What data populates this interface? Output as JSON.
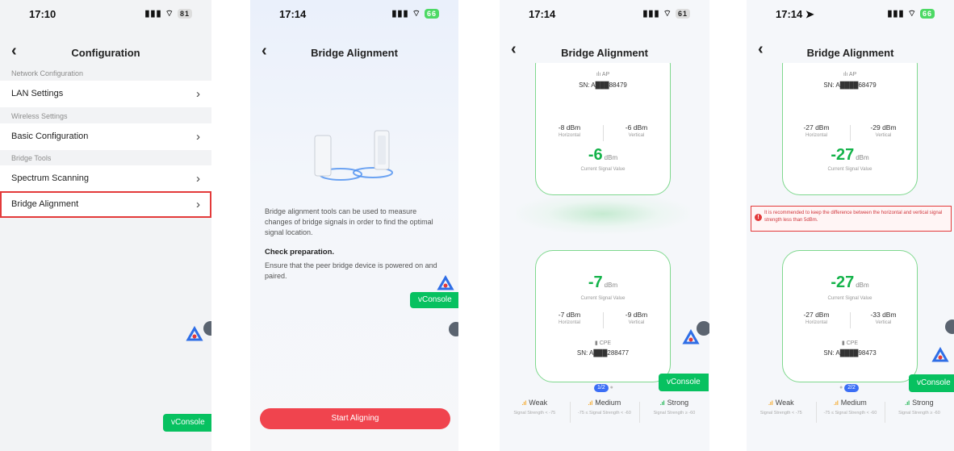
{
  "screen1": {
    "status": {
      "time": "17:10",
      "battery": "81"
    },
    "title": "Configuration",
    "sections": [
      {
        "label": "Network Configuration",
        "items": [
          "LAN Settings"
        ]
      },
      {
        "label": "Wireless Settings",
        "items": [
          "Basic Configuration"
        ]
      },
      {
        "label": "Bridge Tools",
        "items": [
          "Spectrum Scanning",
          "Bridge Alignment"
        ]
      }
    ],
    "vconsole": "vConsole"
  },
  "screen2": {
    "status": {
      "time": "17:14",
      "battery": "66"
    },
    "title": "Bridge Alignment",
    "description": "Bridge alignment tools can be used to measure changes of bridge signals in order to find the optimal signal location.",
    "check_title": "Check preparation.",
    "check_text": "Ensure that the peer bridge device is powered on and paired.",
    "start_button": "Start Aligning",
    "vconsole": "vConsole"
  },
  "screen3": {
    "status": {
      "time": "17:14",
      "battery": "61"
    },
    "title": "Bridge Alignment",
    "ap_card": {
      "role": "AP",
      "sn": "SN: A███88479",
      "horizontal": "-8 dBm",
      "vertical": "-6 dBm",
      "h_label": "Horizontal",
      "v_label": "Vertical",
      "current_value": "-6",
      "unit": "dBm",
      "current_label": "Current Signal Value"
    },
    "cpe_card": {
      "role": "CPE",
      "sn": "SN: A███288477",
      "horizontal": "-7 dBm",
      "vertical": "-9 dBm",
      "h_label": "Horizontal",
      "v_label": "Vertical",
      "current_value": "-7",
      "unit": "dBm",
      "current_label": "Current Signal Value"
    },
    "pager": "1/2",
    "vconsole": "vConsole"
  },
  "screen4": {
    "status": {
      "time": "17:14",
      "battery": "66"
    },
    "title": "Bridge Alignment",
    "ap_card": {
      "role": "AP",
      "sn": "SN: A████68479",
      "horizontal": "-27 dBm",
      "vertical": "-29 dBm",
      "h_label": "Horizontal",
      "v_label": "Vertical",
      "current_value": "-27",
      "unit": "dBm",
      "current_label": "Current Signal Value"
    },
    "warning": "It is recommended to keep the difference between the horizontal and vertical signal strength less than 5dBm.",
    "cpe_card": {
      "role": "CPE",
      "sn": "SN: A████98473",
      "horizontal": "-27 dBm",
      "vertical": "-33 dBm",
      "h_label": "Horizontal",
      "v_label": "Vertical",
      "current_value": "-27",
      "unit": "dBm",
      "current_label": "Current Signal Value"
    },
    "pager": "2/2",
    "vconsole": "vConsole"
  },
  "legend": {
    "weak": {
      "name": "Weak",
      "range": "Signal Strength < -75",
      "color": "#f5a623"
    },
    "medium": {
      "name": "Medium",
      "range": "-75 ≤ Signal Strength < -60",
      "color": "#f5a623"
    },
    "strong": {
      "name": "Strong",
      "range": "Signal Strength ≥ -60",
      "color": "#14b34a"
    }
  },
  "colors": {
    "accent_green": "#14b34a",
    "danger": "#e33a3a",
    "start_button": "#f0444e",
    "vconsole": "#07c160"
  }
}
